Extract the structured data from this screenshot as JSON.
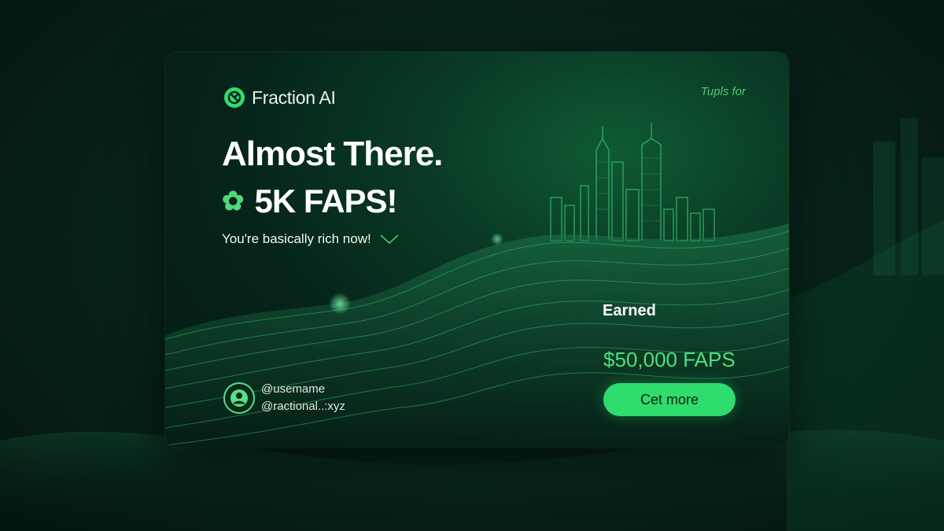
{
  "brand": {
    "name": "Fraction AI",
    "logo_icon": "fraction-logo-icon"
  },
  "top_right_text": "Tupls for",
  "headline": "Almost There.",
  "subheadline": "5K FAPS!",
  "subheadline_icon": "clover-icon",
  "tagline": "You're basically rich now!",
  "tagline_icon": "checkmark-icon",
  "user": {
    "username": "@usemame",
    "handle": "@ractional..:xyz",
    "avatar_icon": "user-avatar-icon"
  },
  "earned": {
    "label": "Earned",
    "value": "$50,000 FAPS"
  },
  "cta": {
    "label": "Cet more"
  },
  "colors": {
    "accent": "#2fdc6e",
    "accent_text": "#4fe07e",
    "background": "#06241a"
  }
}
